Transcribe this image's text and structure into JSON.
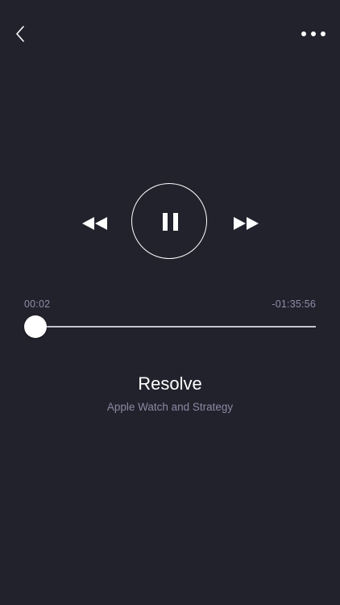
{
  "nav": {
    "back_icon": "chevron-left-icon",
    "more_icon": "more-horizontal-icon"
  },
  "controls": {
    "rewind_icon": "rewind-icon",
    "pause_icon": "pause-icon",
    "forward_icon": "fast-forward-icon",
    "state": "playing"
  },
  "progress": {
    "elapsed": "00:02",
    "remaining": "-01:35:56",
    "fraction": 0.0003
  },
  "track": {
    "title": "Resolve",
    "subtitle": "Apple Watch and Strategy"
  },
  "colors": {
    "background": "#22222d",
    "foreground": "#ffffff",
    "muted_text": "#8e8ea8",
    "track": "#c4c4cc"
  }
}
